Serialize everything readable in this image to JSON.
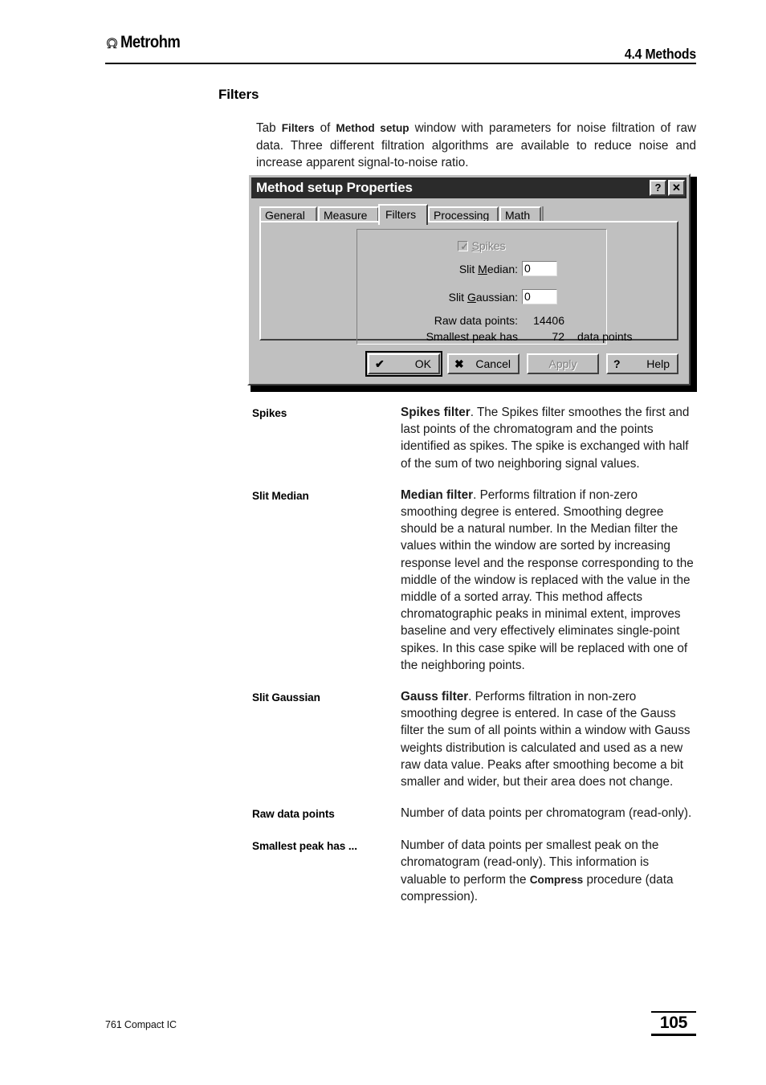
{
  "header": {
    "brand": "Metrohm",
    "brand_icon": "omega-logo-icon",
    "section_ref": "4.4 Methods"
  },
  "section": {
    "title": "Filters",
    "intro_prefix": "Tab ",
    "intro_bold_1": "Filters",
    "intro_mid": " of ",
    "intro_bold_2": "Method setup",
    "intro_suffix": " window with parameters for noise filtration of raw data. Three different filtration algorithms are available to reduce noise and increase apparent signal-to-noise ratio."
  },
  "dialog": {
    "title": "Method setup Properties",
    "titlebar_buttons": [
      {
        "label": "?",
        "name": "help-titlebar-button"
      },
      {
        "label": "✕",
        "name": "close-titlebar-button"
      }
    ],
    "tabs": [
      {
        "label": "General",
        "active": false
      },
      {
        "label": "Measure",
        "active": false
      },
      {
        "label": "Filters",
        "active": true
      },
      {
        "label": "Processing",
        "active": false
      },
      {
        "label": "Math",
        "active": false
      }
    ],
    "checkbox": {
      "label_pre": "",
      "label_mnemonic": "S",
      "label_post": "pikes",
      "checked": true,
      "disabled": true
    },
    "fields": [
      {
        "label_pre": "Slit ",
        "label_mnemonic": "M",
        "label_post": "edian:",
        "value": "0"
      },
      {
        "label_pre": "Slit ",
        "label_mnemonic": "G",
        "label_post": "aussian:",
        "value": "0"
      }
    ],
    "readonly": [
      {
        "label": "Raw data points:",
        "value": "14406",
        "unit": ""
      },
      {
        "label": "Smallest peak has",
        "value": "72",
        "unit": "data points"
      }
    ],
    "buttons": [
      {
        "icon": "✔",
        "icon_name": "check-icon",
        "label": "OK",
        "disabled": false,
        "focused": true
      },
      {
        "icon": "✖",
        "icon_name": "cross-icon",
        "label": "Cancel",
        "disabled": false,
        "focused": false
      },
      {
        "icon": "",
        "icon_name": "none",
        "label": "Apply",
        "disabled": true,
        "focused": false
      },
      {
        "icon": "?",
        "icon_name": "question-icon",
        "label": "Help",
        "disabled": false,
        "focused": false
      }
    ]
  },
  "definitions": [
    {
      "term": "Spikes",
      "desc_bold": "Spikes filter",
      "desc_rest": ". The Spikes filter smoothes the first and last points of the chromatogram and the points identified as spikes. The spike is exchanged with half of the sum of two neighboring signal values."
    },
    {
      "term": "Slit Median",
      "desc_bold": "Median filter",
      "desc_rest": ". Performs filtration if non-zero smoothing degree is entered. Smoothing degree should be a natural number. In the Median filter the values within the window are sorted by increasing response level and the response corresponding to the middle of the window is replaced with the value in the middle of a sorted array. This method affects chromatographic peaks in minimal extent, improves baseline and very effectively eliminates single-point spikes. In this case spike will be replaced with one of the neighboring points."
    },
    {
      "term": "Slit Gaussian",
      "desc_bold": "Gauss filter",
      "desc_rest": ". Performs filtration in non-zero smoothing degree is entered. In case of the Gauss filter the sum of all points within a window with Gauss weights distribution is calculated and used as a new raw data value. Peaks after smoothing become a bit smaller and wider, but their area does not change."
    },
    {
      "term": "Raw data points",
      "desc_bold": "",
      "desc_rest": "Number of data points per chromatogram (read-only)."
    },
    {
      "term": "Smallest peak has ...",
      "desc_bold": "",
      "desc_rest_a": "Number of data points per smallest peak on the chromatogram (read-only). This information is valuable to perform the ",
      "desc_inline_bold": "Compress",
      "desc_rest_b": " procedure (data compression)."
    }
  ],
  "footer": {
    "product": "761 Compact IC",
    "page_number": "105"
  }
}
